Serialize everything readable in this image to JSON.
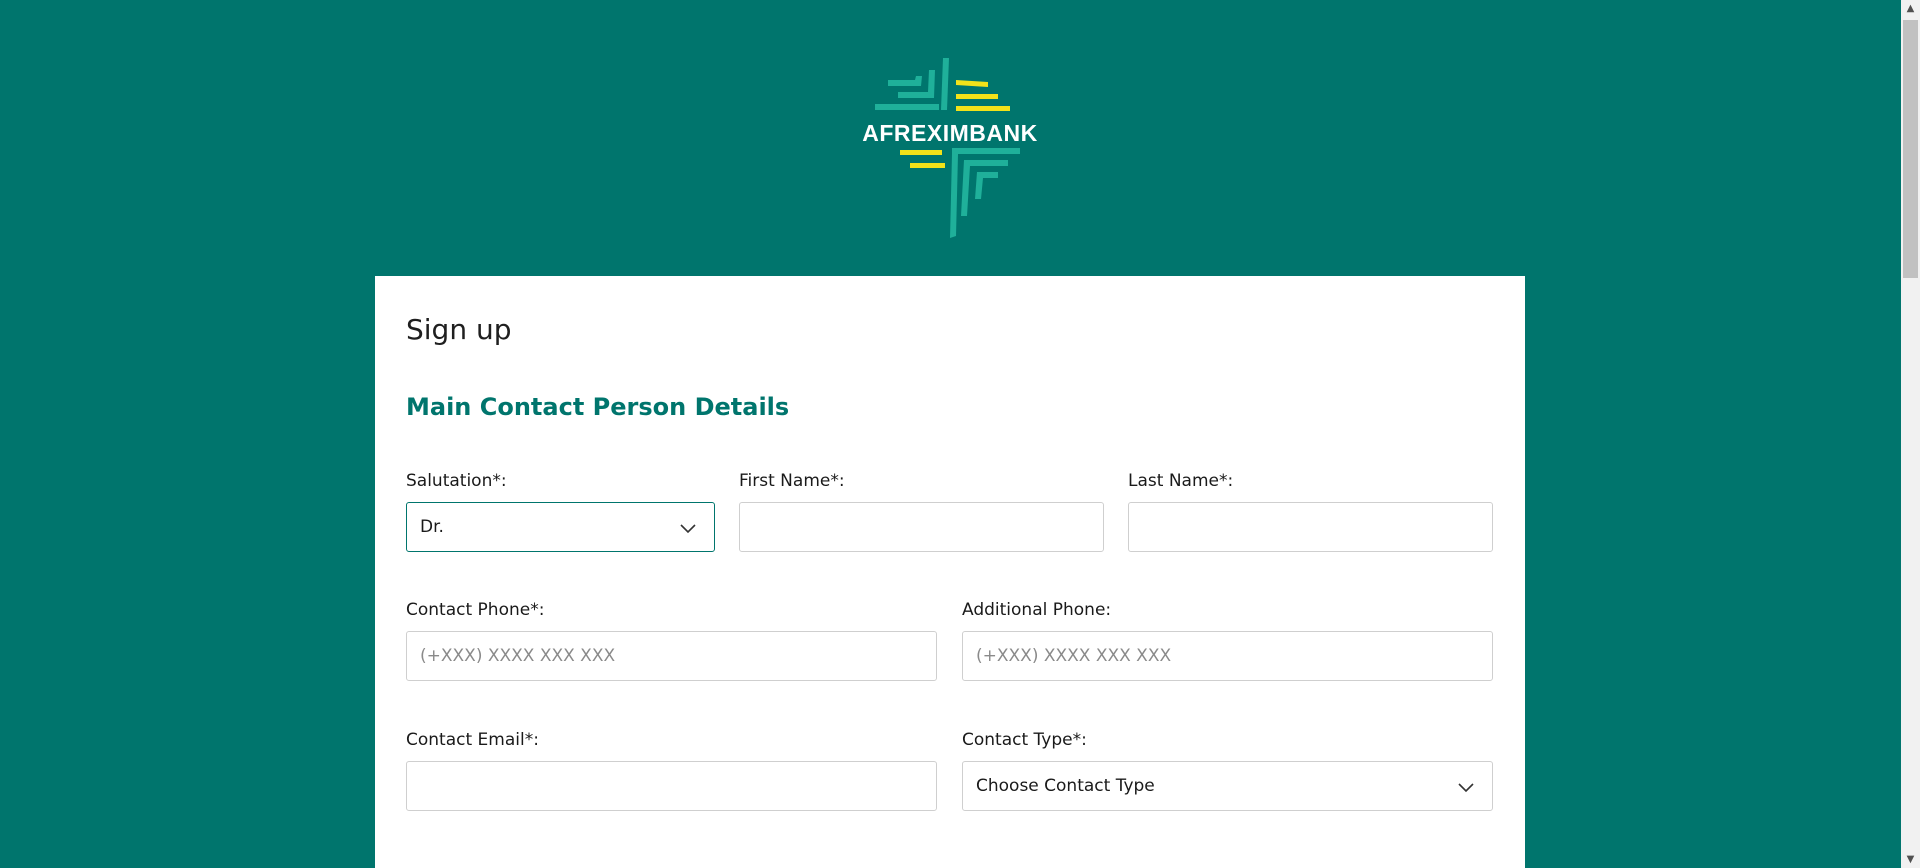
{
  "brand": {
    "name": "AFREXIMBANK",
    "colors": {
      "background": "#00756d",
      "accent_green": "#1fb09a",
      "accent_yellow": "#f2e21a"
    }
  },
  "form": {
    "title": "Sign up",
    "section_title": "Main Contact Person Details",
    "salutation": {
      "label": "Salutation*:",
      "value": "Dr."
    },
    "first_name": {
      "label": "First Name*:",
      "value": ""
    },
    "last_name": {
      "label": "Last Name*:",
      "value": ""
    },
    "contact_phone": {
      "label": "Contact Phone*:",
      "placeholder": "(+XXX) XXXX XXX XXX"
    },
    "additional_phone": {
      "label": "Additional Phone:",
      "placeholder": "(+XXX) XXXX XXX XXX"
    },
    "contact_email": {
      "label": "Contact Email*:",
      "value": ""
    },
    "contact_type": {
      "label": "Contact Type*:",
      "value": "Choose Contact Type"
    }
  },
  "icons": {
    "chevron": "chevron-down-icon",
    "scroll_up": "scroll-up-arrow-icon",
    "scroll_down": "scroll-down-arrow-icon"
  }
}
